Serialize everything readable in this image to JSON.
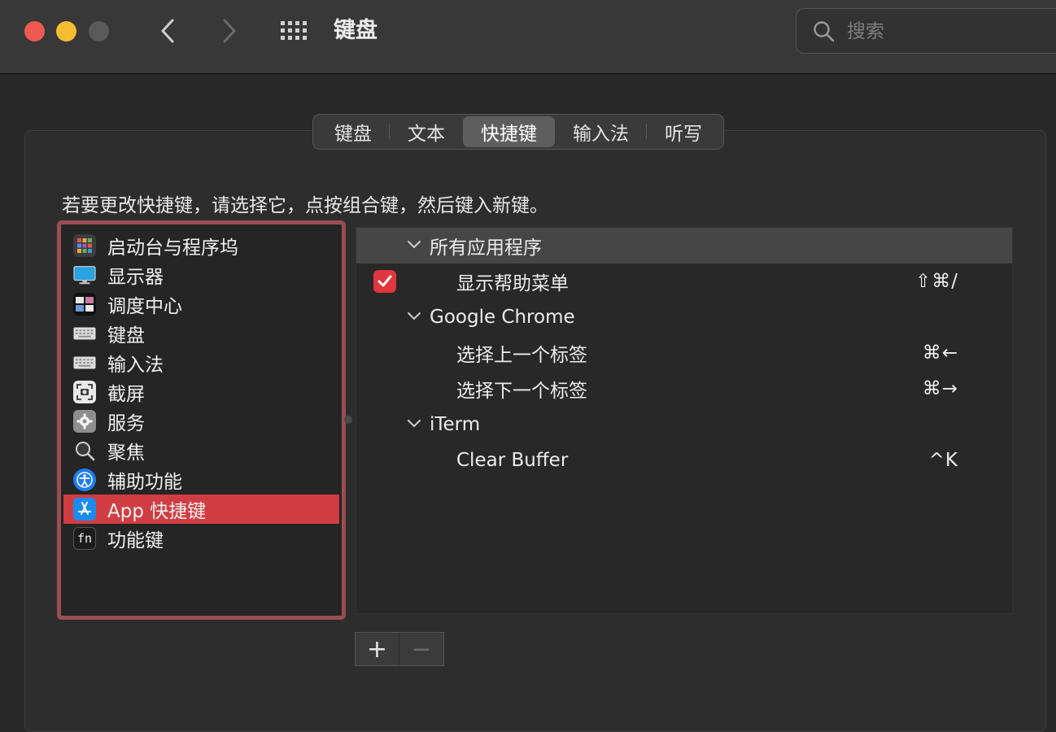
{
  "window": {
    "title": "键盘",
    "search_placeholder": "搜索"
  },
  "tabs": [
    {
      "label": "键盘"
    },
    {
      "label": "文本"
    },
    {
      "label": "快捷键"
    },
    {
      "label": "输入法"
    },
    {
      "label": "听写"
    }
  ],
  "active_tab": "快捷键",
  "hint": "若要更改快捷键，请选择它，点按组合键，然后键入新键。",
  "categories": [
    {
      "label": "启动台与程序坞",
      "icon": "launchpad-icon"
    },
    {
      "label": "显示器",
      "icon": "display-icon"
    },
    {
      "label": "调度中心",
      "icon": "mission-control-icon"
    },
    {
      "label": "键盘",
      "icon": "keyboard-icon"
    },
    {
      "label": "输入法",
      "icon": "input-method-icon"
    },
    {
      "label": "截屏",
      "icon": "screenshot-icon"
    },
    {
      "label": "服务",
      "icon": "services-gear-icon"
    },
    {
      "label": "聚焦",
      "icon": "spotlight-icon"
    },
    {
      "label": "辅助功能",
      "icon": "accessibility-icon"
    },
    {
      "label": "App 快捷键",
      "icon": "app-store-icon",
      "selected": true
    },
    {
      "label": "功能键",
      "icon": "fn-key-icon"
    }
  ],
  "shortcuts": {
    "group1": {
      "label": "所有应用程序"
    },
    "item1": {
      "label": "显示帮助菜单",
      "keys": "⇧⌘/",
      "checked": true
    },
    "group2": {
      "label": "Google Chrome"
    },
    "item2": {
      "label": "选择上一个标签",
      "keys": "⌘←"
    },
    "item3": {
      "label": "选择下一个标签",
      "keys": "⌘→"
    },
    "group3": {
      "label": "iTerm"
    },
    "item4": {
      "label": "Clear Buffer",
      "keys": "^K"
    }
  },
  "buttons": {
    "add": "+",
    "remove": "−"
  },
  "colors": {
    "accent_red": "#d03d42",
    "checkbox_red": "#e0363e",
    "selection_border": "#9a4e54"
  }
}
